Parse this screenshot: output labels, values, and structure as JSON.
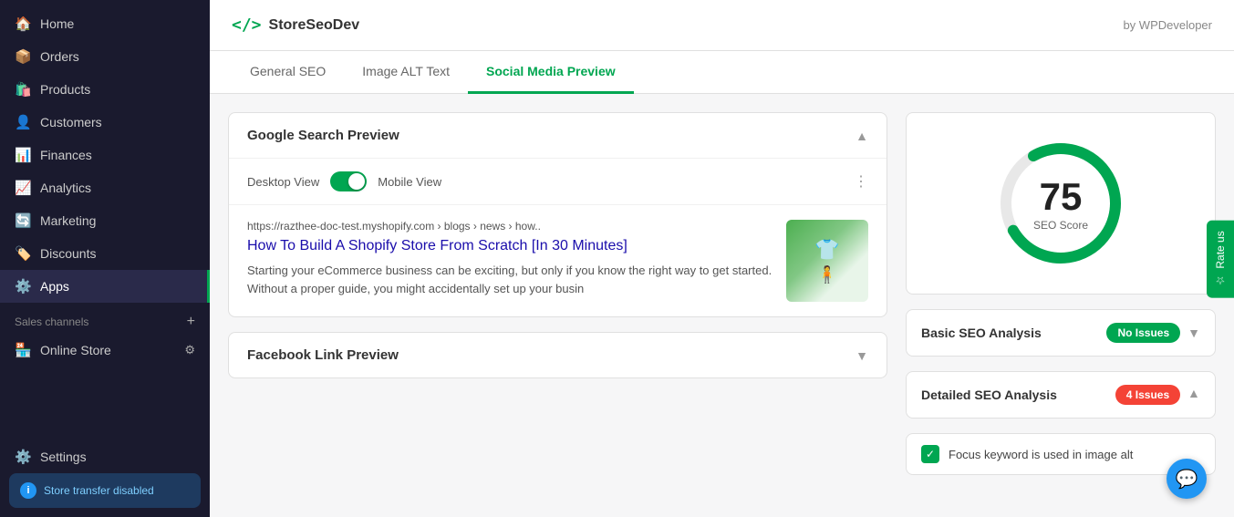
{
  "sidebar": {
    "items": [
      {
        "id": "home",
        "label": "Home",
        "icon": "🏠",
        "active": false
      },
      {
        "id": "orders",
        "label": "Orders",
        "icon": "📦",
        "active": false
      },
      {
        "id": "products",
        "label": "Products",
        "icon": "🛍️",
        "active": false
      },
      {
        "id": "customers",
        "label": "Customers",
        "icon": "👤",
        "active": false
      },
      {
        "id": "finances",
        "label": "Finances",
        "icon": "📊",
        "active": false
      },
      {
        "id": "analytics",
        "label": "Analytics",
        "icon": "📈",
        "active": false
      },
      {
        "id": "marketing",
        "label": "Marketing",
        "icon": "🔄",
        "active": false
      },
      {
        "id": "discounts",
        "label": "Discounts",
        "icon": "🏷️",
        "active": false
      },
      {
        "id": "apps",
        "label": "Apps",
        "icon": "⚙️",
        "active": true
      }
    ],
    "sales_channels_label": "Sales channels",
    "online_store": "Online Store",
    "settings": "Settings",
    "store_transfer": "Store transfer disabled"
  },
  "topbar": {
    "brand_icon": "</>",
    "brand_name": "StoreSeoDev",
    "by_label": "by WPDeveloper"
  },
  "tabs": [
    {
      "id": "general-seo",
      "label": "General SEO",
      "active": false
    },
    {
      "id": "image-alt-text",
      "label": "Image ALT Text",
      "active": false
    },
    {
      "id": "social-media-preview",
      "label": "Social Media Preview",
      "active": true
    }
  ],
  "google_search_preview": {
    "title": "Google Search Preview",
    "view_desktop_label": "Desktop View",
    "view_mobile_label": "Mobile View",
    "toggle_on": true,
    "url": "https://razthee-doc-test.myshopify.com › blogs › news › how..",
    "search_title": "How To Build A Shopify Store From Scratch [In 30 Minutes]",
    "description": "Starting your eCommerce business can be exciting, but only if you know the right way to get started. Without a proper guide, you might accidentally set up your busin"
  },
  "facebook_link_preview": {
    "title": "Facebook Link Preview",
    "collapsed": true
  },
  "seo_score": {
    "score": "75",
    "label": "SEO Score",
    "circle_color": "#00a651",
    "circle_bg": "#e0e0e0"
  },
  "basic_seo": {
    "label": "Basic SEO Analysis",
    "badge": "No Issues",
    "badge_color": "green"
  },
  "detailed_seo": {
    "label": "Detailed SEO Analysis",
    "badge": "4 Issues",
    "badge_color": "red",
    "collapsed": false
  },
  "focus_keyword": {
    "text": "Focus keyword is used in image alt"
  },
  "rate_us": "Rate us",
  "chat_icon": "💬"
}
